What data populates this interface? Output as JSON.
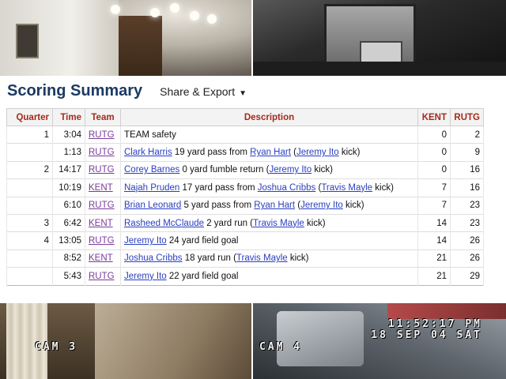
{
  "camera": {
    "cam3_label": "CAM 3",
    "cam4_label": "CAM 4",
    "time": "11:52:17 PM",
    "date": "18 SEP 04 SAT"
  },
  "summary": {
    "title": "Scoring Summary",
    "share_label": "Share & Export",
    "share_caret": "▼",
    "columns": {
      "quarter": "Quarter",
      "time": "Time",
      "team": "Team",
      "description": "Description",
      "kent": "KENT",
      "rutg": "RUTG"
    },
    "rows": [
      {
        "quarter": "1",
        "time": "3:04",
        "team": "RUTG",
        "segments": [
          {
            "t": "TEAM safety"
          }
        ],
        "kent": "0",
        "rutg": "2"
      },
      {
        "quarter": "",
        "time": "1:13",
        "team": "RUTG",
        "segments": [
          {
            "t": "Clark Harris",
            "link": true
          },
          {
            "t": " 19 yard pass from "
          },
          {
            "t": "Ryan Hart",
            "link": true
          },
          {
            "t": " ("
          },
          {
            "t": "Jeremy Ito",
            "link": true
          },
          {
            "t": " kick)"
          }
        ],
        "kent": "0",
        "rutg": "9"
      },
      {
        "quarter": "2",
        "time": "14:17",
        "team": "RUTG",
        "segments": [
          {
            "t": "Corey Barnes",
            "link": true
          },
          {
            "t": " 0 yard fumble return ("
          },
          {
            "t": "Jeremy Ito",
            "link": true
          },
          {
            "t": " kick)"
          }
        ],
        "kent": "0",
        "rutg": "16"
      },
      {
        "quarter": "",
        "time": "10:19",
        "team": "KENT",
        "segments": [
          {
            "t": "Najah Pruden",
            "link": true
          },
          {
            "t": " 17 yard pass from "
          },
          {
            "t": "Joshua Cribbs",
            "link": true
          },
          {
            "t": " ("
          },
          {
            "t": "Travis Mayle",
            "link": true
          },
          {
            "t": " kick)"
          }
        ],
        "kent": "7",
        "rutg": "16"
      },
      {
        "quarter": "",
        "time": "6:10",
        "team": "RUTG",
        "segments": [
          {
            "t": "Brian Leonard",
            "link": true
          },
          {
            "t": " 5 yard pass from "
          },
          {
            "t": "Ryan Hart",
            "link": true
          },
          {
            "t": " ("
          },
          {
            "t": "Jeremy Ito",
            "link": true
          },
          {
            "t": " kick)"
          }
        ],
        "kent": "7",
        "rutg": "23"
      },
      {
        "quarter": "3",
        "time": "6:42",
        "team": "KENT",
        "segments": [
          {
            "t": "Rasheed McClaude",
            "link": true
          },
          {
            "t": " 2 yard run ("
          },
          {
            "t": "Travis Mayle",
            "link": true
          },
          {
            "t": " kick)"
          }
        ],
        "kent": "14",
        "rutg": "23"
      },
      {
        "quarter": "4",
        "time": "13:05",
        "team": "RUTG",
        "segments": [
          {
            "t": "Jeremy Ito",
            "link": true
          },
          {
            "t": " 24 yard field goal"
          }
        ],
        "kent": "14",
        "rutg": "26"
      },
      {
        "quarter": "",
        "time": "8:52",
        "team": "KENT",
        "segments": [
          {
            "t": "Joshua Cribbs",
            "link": true
          },
          {
            "t": " 18 yard run ("
          },
          {
            "t": "Travis Mayle",
            "link": true
          },
          {
            "t": " kick)"
          }
        ],
        "kent": "21",
        "rutg": "26"
      },
      {
        "quarter": "",
        "time": "5:43",
        "team": "RUTG",
        "segments": [
          {
            "t": "Jeremy Ito",
            "link": true
          },
          {
            "t": " 22 yard field goal"
          }
        ],
        "kent": "21",
        "rutg": "29"
      }
    ]
  }
}
